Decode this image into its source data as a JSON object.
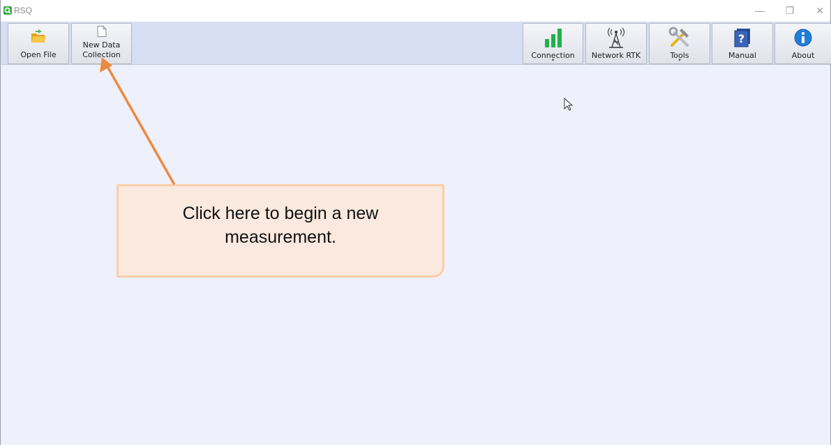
{
  "window": {
    "title": "RSQ",
    "controls": {
      "minimize": "—",
      "maximize": "❐",
      "close": "✕"
    }
  },
  "toolbar": {
    "left_buttons": [
      {
        "id": "open-file",
        "label": "Open File",
        "icon": "folder-open-icon"
      },
      {
        "id": "new-data-collection",
        "label_line1": "New Data",
        "label_line2": "Collection",
        "icon": "blank-document-icon"
      }
    ],
    "right_buttons": [
      {
        "id": "connection",
        "label": "Connection",
        "icon": "signal-bars-icon",
        "has_dropdown": true
      },
      {
        "id": "network-rtk",
        "label": "Network RTK",
        "icon": "antenna-tower-icon",
        "has_dropdown": false
      },
      {
        "id": "tools",
        "label": "Tools",
        "icon": "wrench-hammer-icon",
        "has_dropdown": true
      },
      {
        "id": "manual",
        "label": "Manual",
        "icon": "help-book-icon",
        "has_dropdown": false
      },
      {
        "id": "about",
        "label": "About",
        "icon": "info-circle-icon",
        "has_dropdown": false
      }
    ],
    "dropdown_caret": "▼"
  },
  "callout": {
    "line1": "Click here to begin a new",
    "line2": "measurement."
  },
  "colors": {
    "toolbar_bg": "#d7ddf3",
    "workspace_bg": "#eef0fb",
    "arrow": "#ec8a3e",
    "callout_bg": "#f9e9df",
    "callout_border": "#f9cfa8",
    "signal_green": "#22b14c",
    "info_blue": "#1f7fd6"
  }
}
